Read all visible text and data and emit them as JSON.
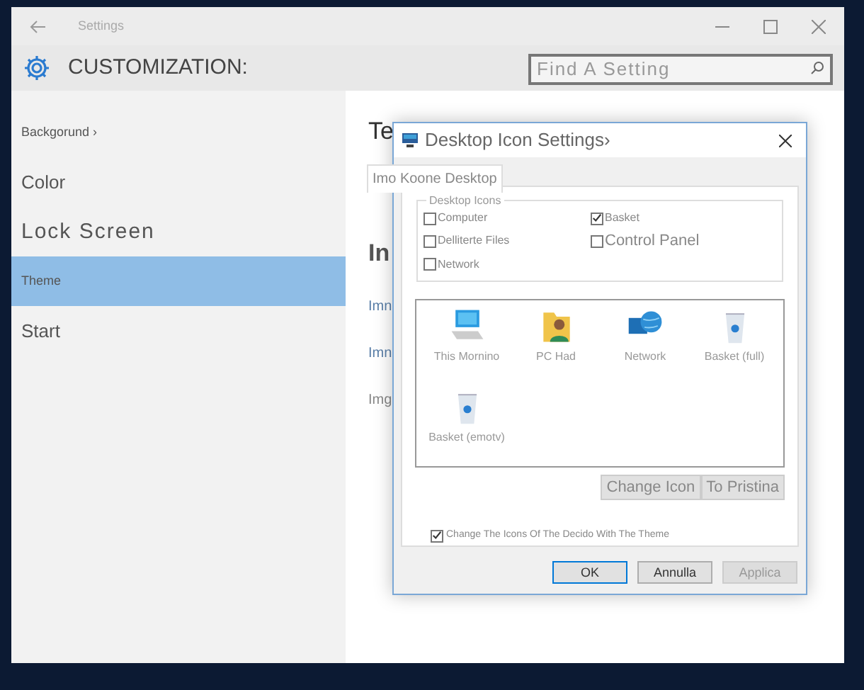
{
  "window": {
    "title": "Settings"
  },
  "header": {
    "title": "CUSTOMIZATION:",
    "search": {
      "placeholder": "Find A Setting"
    }
  },
  "sidebar": {
    "items": [
      {
        "label": "Backgorund ›",
        "selected": false
      },
      {
        "label": "Color",
        "selected": false
      },
      {
        "label": "Lock Screen",
        "selected": false
      },
      {
        "label": "Theme",
        "selected": true
      },
      {
        "label": "Start",
        "selected": false
      }
    ]
  },
  "content": {
    "items": [
      {
        "text": "Te",
        "kind": "heading"
      },
      {
        "text": "In",
        "kind": "subheading"
      },
      {
        "text": "Imn",
        "kind": "link"
      },
      {
        "text": "Imn",
        "kind": "link"
      },
      {
        "text": "Img",
        "kind": "text"
      }
    ]
  },
  "dialog": {
    "title": "Desktop Icon Settings›",
    "tab": "Imo Koone Desktop",
    "group": "Desktop Icons",
    "checkboxes": [
      {
        "label": "Computer",
        "checked": false
      },
      {
        "label": "Basket",
        "checked": true
      },
      {
        "label": "Delliterte Files",
        "checked": false
      },
      {
        "label": "Control Panel",
        "checked": false
      },
      {
        "label": "Network",
        "checked": false
      }
    ],
    "icons": [
      {
        "label": "This Mornino",
        "kind": "monitor"
      },
      {
        "label": "PC Had",
        "kind": "user"
      },
      {
        "label": "Network",
        "kind": "globe"
      },
      {
        "label": "Basket (full)",
        "kind": "bin"
      },
      {
        "label": "Basket (emotv)",
        "kind": "bin"
      }
    ],
    "icon_buttons": [
      "Change Icon",
      "To Pristina"
    ],
    "theme_checkbox": {
      "label": "Change The Icons Of The Decido With The Theme",
      "checked": true
    },
    "buttons": [
      {
        "label": "OK",
        "selected": true,
        "disabled": false
      },
      {
        "label": "Annulla",
        "selected": false,
        "disabled": false
      },
      {
        "label": "Applica",
        "selected": false,
        "disabled": true
      }
    ]
  }
}
